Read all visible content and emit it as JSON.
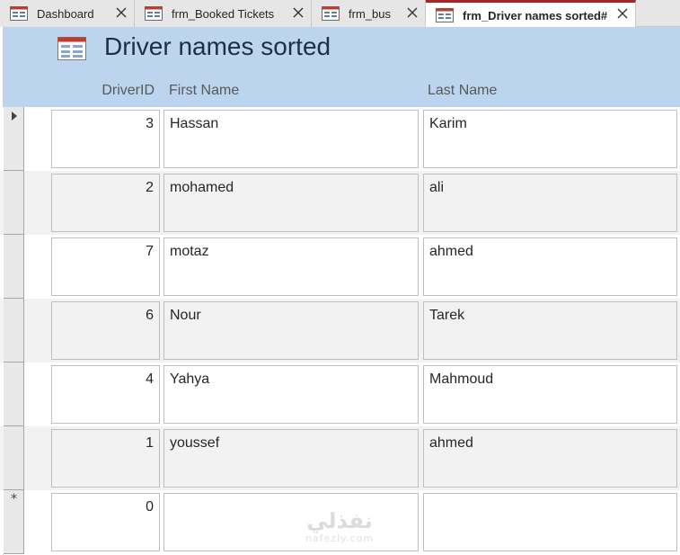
{
  "tabs": [
    {
      "label": "Dashboard",
      "icon": "form-icon",
      "active": false
    },
    {
      "label": "frm_Booked Tickets",
      "icon": "form-icon",
      "active": false
    },
    {
      "label": "frm_bus",
      "icon": "form-icon",
      "active": false
    },
    {
      "label": "frm_Driver names sorted#",
      "icon": "form-icon",
      "active": true
    }
  ],
  "form": {
    "title": "Driver names sorted",
    "icon": "form-icon",
    "columns": {
      "driver_id": "DriverID",
      "first_name": "First Name",
      "last_name": "Last Name"
    }
  },
  "records": [
    {
      "driver_id": "3",
      "first_name": "Hassan",
      "last_name": "Karim",
      "current": true
    },
    {
      "driver_id": "2",
      "first_name": "mohamed",
      "last_name": "ali",
      "current": false
    },
    {
      "driver_id": "7",
      "first_name": "motaz",
      "last_name": "ahmed",
      "current": false
    },
    {
      "driver_id": "6",
      "first_name": "Nour",
      "last_name": "Tarek",
      "current": false
    },
    {
      "driver_id": "4",
      "first_name": "Yahya",
      "last_name": "Mahmoud",
      "current": false
    },
    {
      "driver_id": "1",
      "first_name": "youssef",
      "last_name": "ahmed",
      "current": false
    }
  ],
  "new_record": {
    "marker": "*",
    "driver_id": "0",
    "first_name": "",
    "last_name": ""
  },
  "watermark": {
    "main": "نفذلي",
    "sub": "nafezly.com"
  },
  "colors": {
    "header_bg": "#bcd4ee",
    "active_tab_accent": "#a4262c",
    "title": "#1e2e45",
    "alt_row": "#f2f2f2"
  }
}
